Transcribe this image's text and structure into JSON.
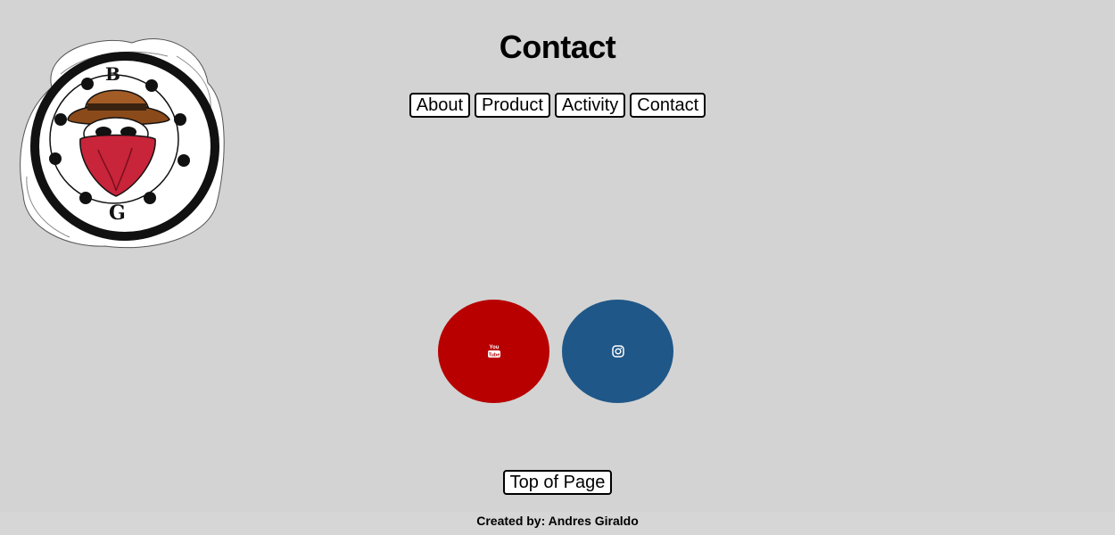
{
  "header": {
    "title": "Contact",
    "logo": {
      "icon": "bandit-skull-logo-icon",
      "letters": [
        "B",
        "G"
      ]
    }
  },
  "nav": {
    "items": [
      {
        "label": "About"
      },
      {
        "label": "Product"
      },
      {
        "label": "Activity"
      },
      {
        "label": "Contact"
      }
    ]
  },
  "social": {
    "youtube": {
      "icon": "youtube-icon",
      "color": "#b80000",
      "text_top": "You",
      "text_bottom": "Tube"
    },
    "instagram": {
      "icon": "instagram-icon",
      "color": "#1f5788"
    }
  },
  "top_button": {
    "label": "Top of Page"
  },
  "footer": {
    "text": "Created by: Andres Giraldo"
  }
}
